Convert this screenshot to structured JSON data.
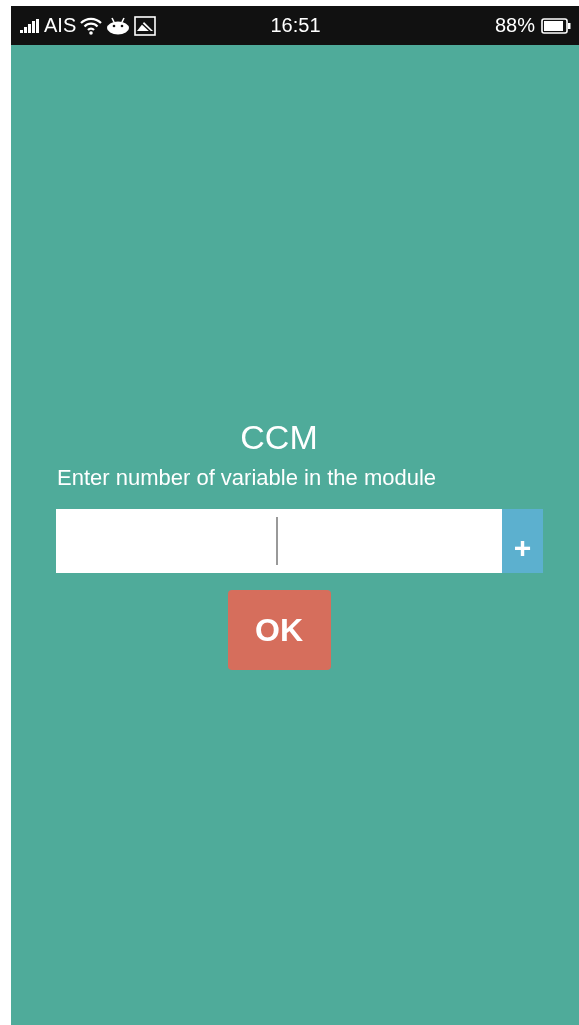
{
  "status_bar": {
    "carrier": "AIS",
    "time": "16:51",
    "battery": "88%"
  },
  "title": "CCM",
  "prompt": "Enter number of variable in the module",
  "field": {
    "focused": true,
    "add_button": "+"
  },
  "ok_button": "OK"
}
